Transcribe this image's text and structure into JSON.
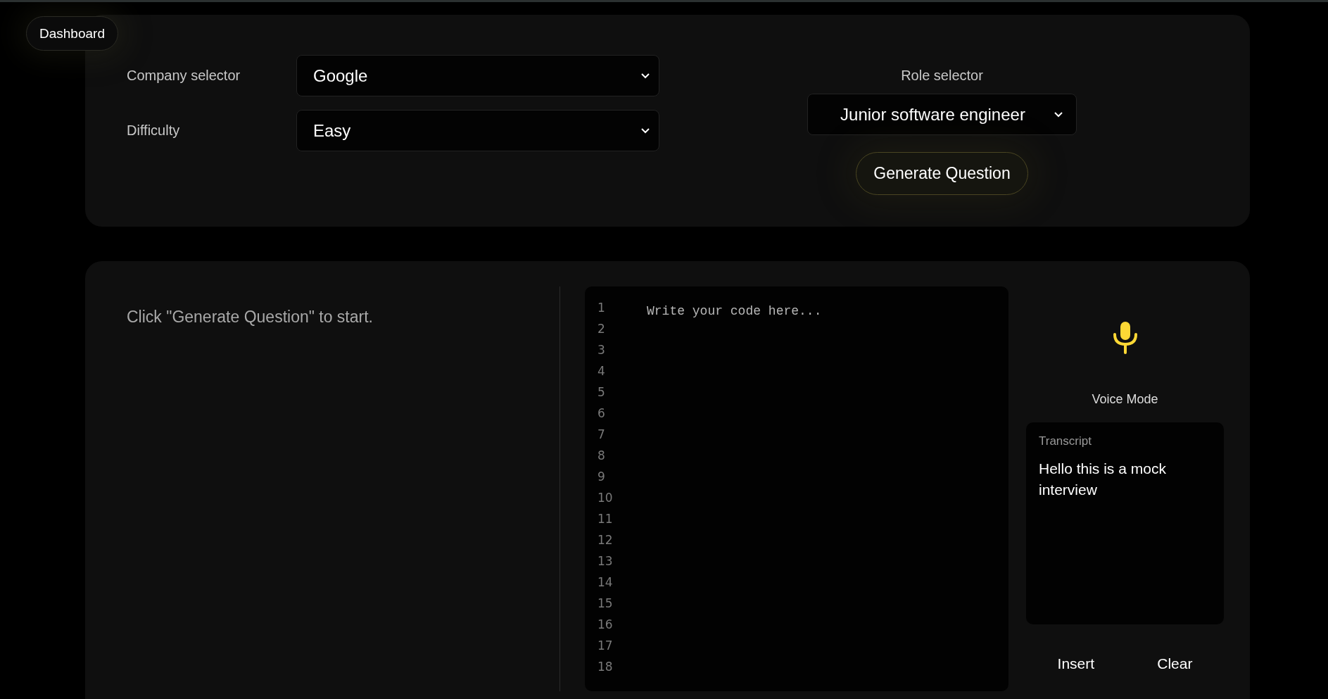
{
  "nav": {
    "dashboard_button": "Dashboard"
  },
  "settings": {
    "company": {
      "label": "Company selector",
      "value": "Google"
    },
    "difficulty": {
      "label": "Difficulty",
      "value": "Easy"
    },
    "role": {
      "label": "Role selector",
      "value": "Junior software engineer"
    },
    "generate_button": "Generate Question"
  },
  "question_panel": {
    "message": "Click \"Generate Question\" to start."
  },
  "editor": {
    "placeholder": "Write your code here...",
    "line_numbers": [
      "1",
      "2",
      "3",
      "4",
      "5",
      "6",
      "7",
      "8",
      "9",
      "10",
      "11",
      "12",
      "13",
      "14",
      "15",
      "16",
      "17",
      "18"
    ]
  },
  "voice": {
    "label": "Voice Mode",
    "transcript_title": "Transcript",
    "transcript_text": "Hello this is a mock interview",
    "buttons": [
      "Insert",
      "Clear"
    ]
  }
}
